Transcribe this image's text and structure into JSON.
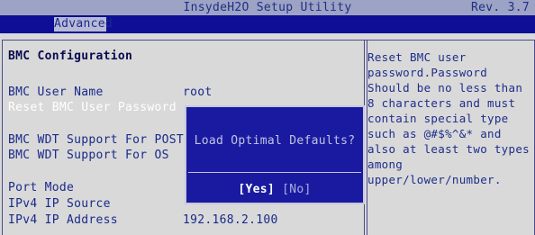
{
  "title_bar": {
    "title": "InsydeH2O Setup Utility",
    "revision": "Rev. 3.7"
  },
  "menu": {
    "active_tab": "Advanced"
  },
  "main": {
    "section_title": "BMC Configuration",
    "rows": [
      {
        "label": "BMC User Name",
        "value": "root"
      },
      {
        "label": "Reset BMC User Password",
        "value": ""
      },
      {
        "label": "BMC WDT Support For POST",
        "value": ""
      },
      {
        "label": "BMC WDT Support For OS",
        "value": ""
      },
      {
        "label": "Port Mode",
        "value": ""
      },
      {
        "label": "IPv4 IP Source",
        "value": ""
      },
      {
        "label": "IPv4 IP Address",
        "value": "192.168.2.100"
      }
    ],
    "selected_row": "Reset BMC User Password"
  },
  "help": {
    "lines": [
      "Reset BMC user",
      "password.Password",
      "Should be no less than",
      "8 characters and must",
      "contain special type",
      "such as @#$%^&* and",
      "also at least two types",
      "among",
      "upper/lower/number."
    ]
  },
  "dialog": {
    "question": "Load Optimal Defaults?",
    "yes_label": "[Yes]",
    "no_label": "[No]"
  },
  "colors": {
    "background": "#d9d9d9",
    "menu_bar": "#0e0e96",
    "dialog": "#1a1aa0",
    "text_blue": "#1a2a8a"
  }
}
